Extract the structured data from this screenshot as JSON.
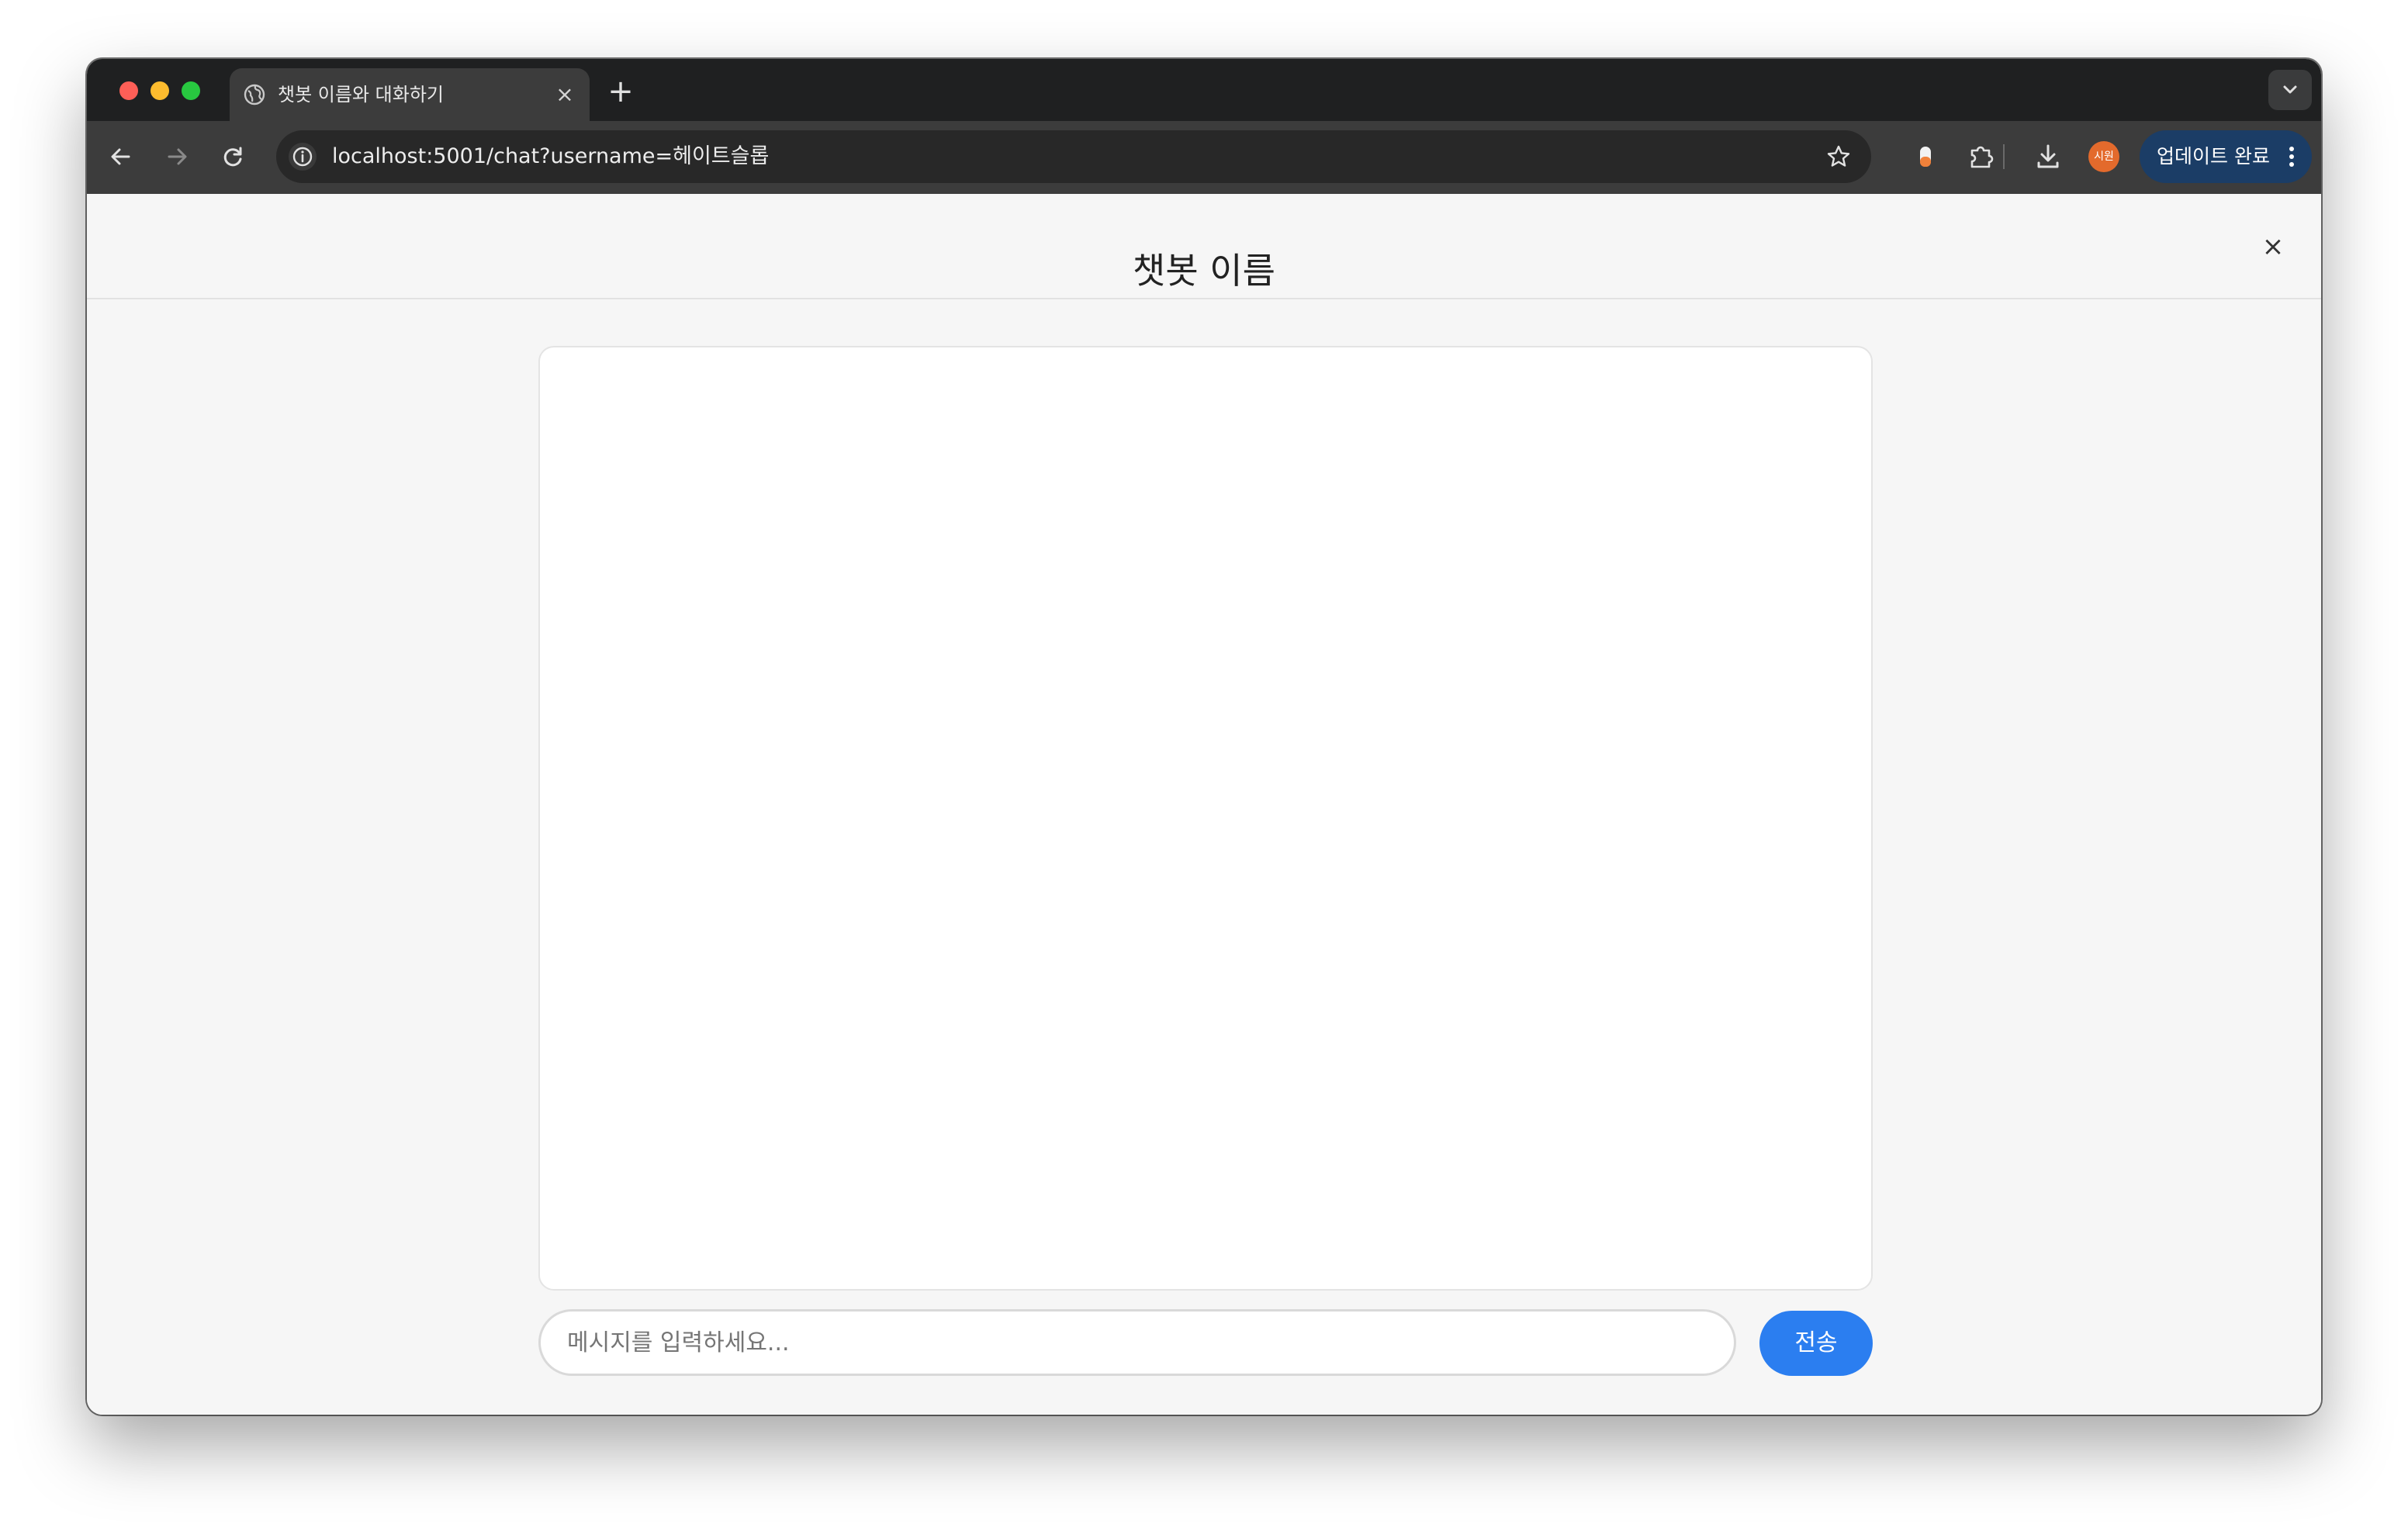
{
  "browser": {
    "tab": {
      "title": "챗봇 이름와 대화하기",
      "close_icon": "close-icon",
      "favicon_icon": "globe-icon"
    },
    "new_tab_icon": "plus-icon",
    "toolbar": {
      "back_icon": "arrow-left-icon",
      "forward_icon": "arrow-right-icon",
      "reload_icon": "reload-icon",
      "url": "localhost:5001/chat?username=헤이트슬롭",
      "bookmark_icon": "star-icon",
      "profile_label": "시원",
      "update_button_label": "업데이트 완료"
    }
  },
  "page": {
    "title": "챗봇 이름",
    "close_glyph": "×",
    "chat": {
      "messages": []
    },
    "composer": {
      "placeholder": "메시지를 입력하세요...",
      "value": "",
      "send_label": "전송"
    }
  },
  "colors": {
    "accent": "#2b7ef0",
    "update_button": "#1b3d66",
    "profile": "#e36a2c"
  }
}
